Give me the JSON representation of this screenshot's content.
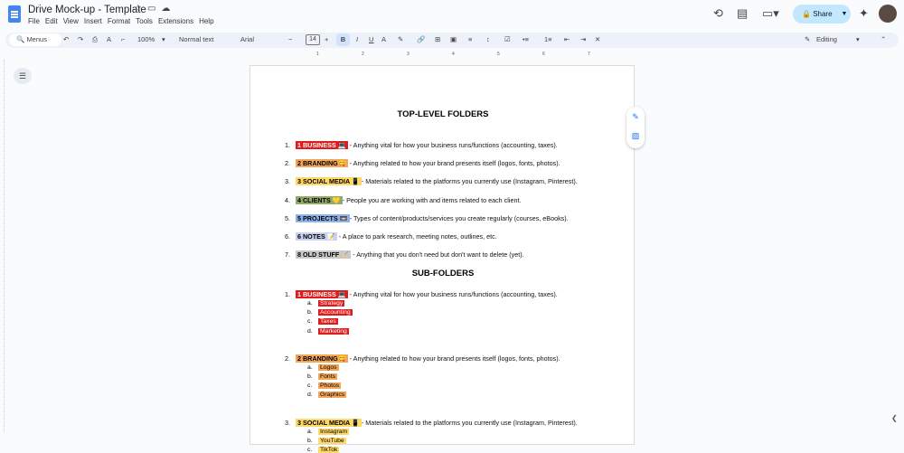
{
  "app": {
    "title": "Drive Mock-up - Template",
    "menus": [
      "File",
      "Edit",
      "View",
      "Insert",
      "Format",
      "Tools",
      "Extensions",
      "Help"
    ],
    "share_label": "Share",
    "colors": {
      "share_bg": "#c2e7ff",
      "doc_icon": "#4285f4",
      "toolbar_bg": "#edf2fa"
    }
  },
  "toolbar": {
    "menus_label": "Menus",
    "zoom": "100%",
    "style": "Normal text",
    "font": "Arial",
    "font_size": "14",
    "mode": "Editing"
  },
  "ruler": [
    "1",
    "2",
    "3",
    "4",
    "5",
    "6",
    "7"
  ],
  "doc": {
    "heading1": "TOP-LEVEL FOLDERS",
    "top_items": [
      {
        "num": "1.",
        "tag": "1  BUSINESS 💻",
        "text": " - Anything vital for how your business runs/functions (accounting, taxes).",
        "bg": "#e01b1b",
        "fg": "#ffffff"
      },
      {
        "num": "2.",
        "tag": "2  BRANDING😋",
        "text": " - Anything related to how your brand presents itself (logos, fonts, photos).",
        "bg": "#f2a65a",
        "fg": "#000000"
      },
      {
        "num": "3.",
        "tag": "3  SOCIAL MEDIA 📱",
        "text": "- Materials related to the platforms you currently use (Instagram, Pinterest).",
        "bg": "#ffd966",
        "fg": "#000000"
      },
      {
        "num": "4.",
        "tag": "4 CLIENTS 💛",
        "text": "- People you are working with and items related to each client.",
        "bg": "#93a86a",
        "fg": "#000000"
      },
      {
        "num": "5.",
        "tag": "5 PROJECTS 📼",
        "text": "- Types of content/products/services you create regularly (courses, eBooks).",
        "bg": "#8fb3e8",
        "fg": "#000000"
      },
      {
        "num": "6.",
        "tag": "6 NOTES 📝",
        "text": " - A place to park research, meeting notes, outlines, etc.",
        "bg": "#c9d3f0",
        "fg": "#000000"
      },
      {
        "num": "7.",
        "tag": "8 OLD STUFF 🧹",
        "text": " - Anything that you don't need but don't want to delete (yet).",
        "bg": "#c8c8c8",
        "fg": "#000000"
      }
    ],
    "heading2": "SUB-FOLDERS",
    "sub_items": [
      {
        "num": "1.",
        "tag": "1 BUSINESS 💻",
        "text": " - Anything vital for how your business runs/functions (accounting, taxes).",
        "bg": "#e01b1b",
        "fg": "#ffffff",
        "subs": [
          {
            "lt": "a.",
            "t": "Strategy"
          },
          {
            "lt": "b.",
            "t": "Accounting"
          },
          {
            "lt": "c.",
            "t": "Taxes"
          },
          {
            "lt": "d.",
            "t": "Marketing"
          }
        ]
      },
      {
        "num": "2.",
        "tag": "2  BRANDING😋",
        "text": " - Anything related to how your brand presents itself (logos, fonts, photos).",
        "bg": "#f2a65a",
        "fg": "#000000",
        "subs": [
          {
            "lt": "a.",
            "t": "Logos"
          },
          {
            "lt": "b.",
            "t": "Fonts"
          },
          {
            "lt": "c.",
            "t": "Photos"
          },
          {
            "lt": "d.",
            "t": "Graphics"
          }
        ]
      },
      {
        "num": "3.",
        "tag": "3  SOCIAL MEDIA 📱",
        "text": "- Materials related to the platforms you currently use (Instagram, Pinterest).",
        "bg": "#ffd966",
        "fg": "#000000",
        "subs": [
          {
            "lt": "a.",
            "t": "Instagram"
          },
          {
            "lt": "b.",
            "t": "YouTube"
          },
          {
            "lt": "c.",
            "t": "TikTok"
          }
        ]
      }
    ]
  }
}
